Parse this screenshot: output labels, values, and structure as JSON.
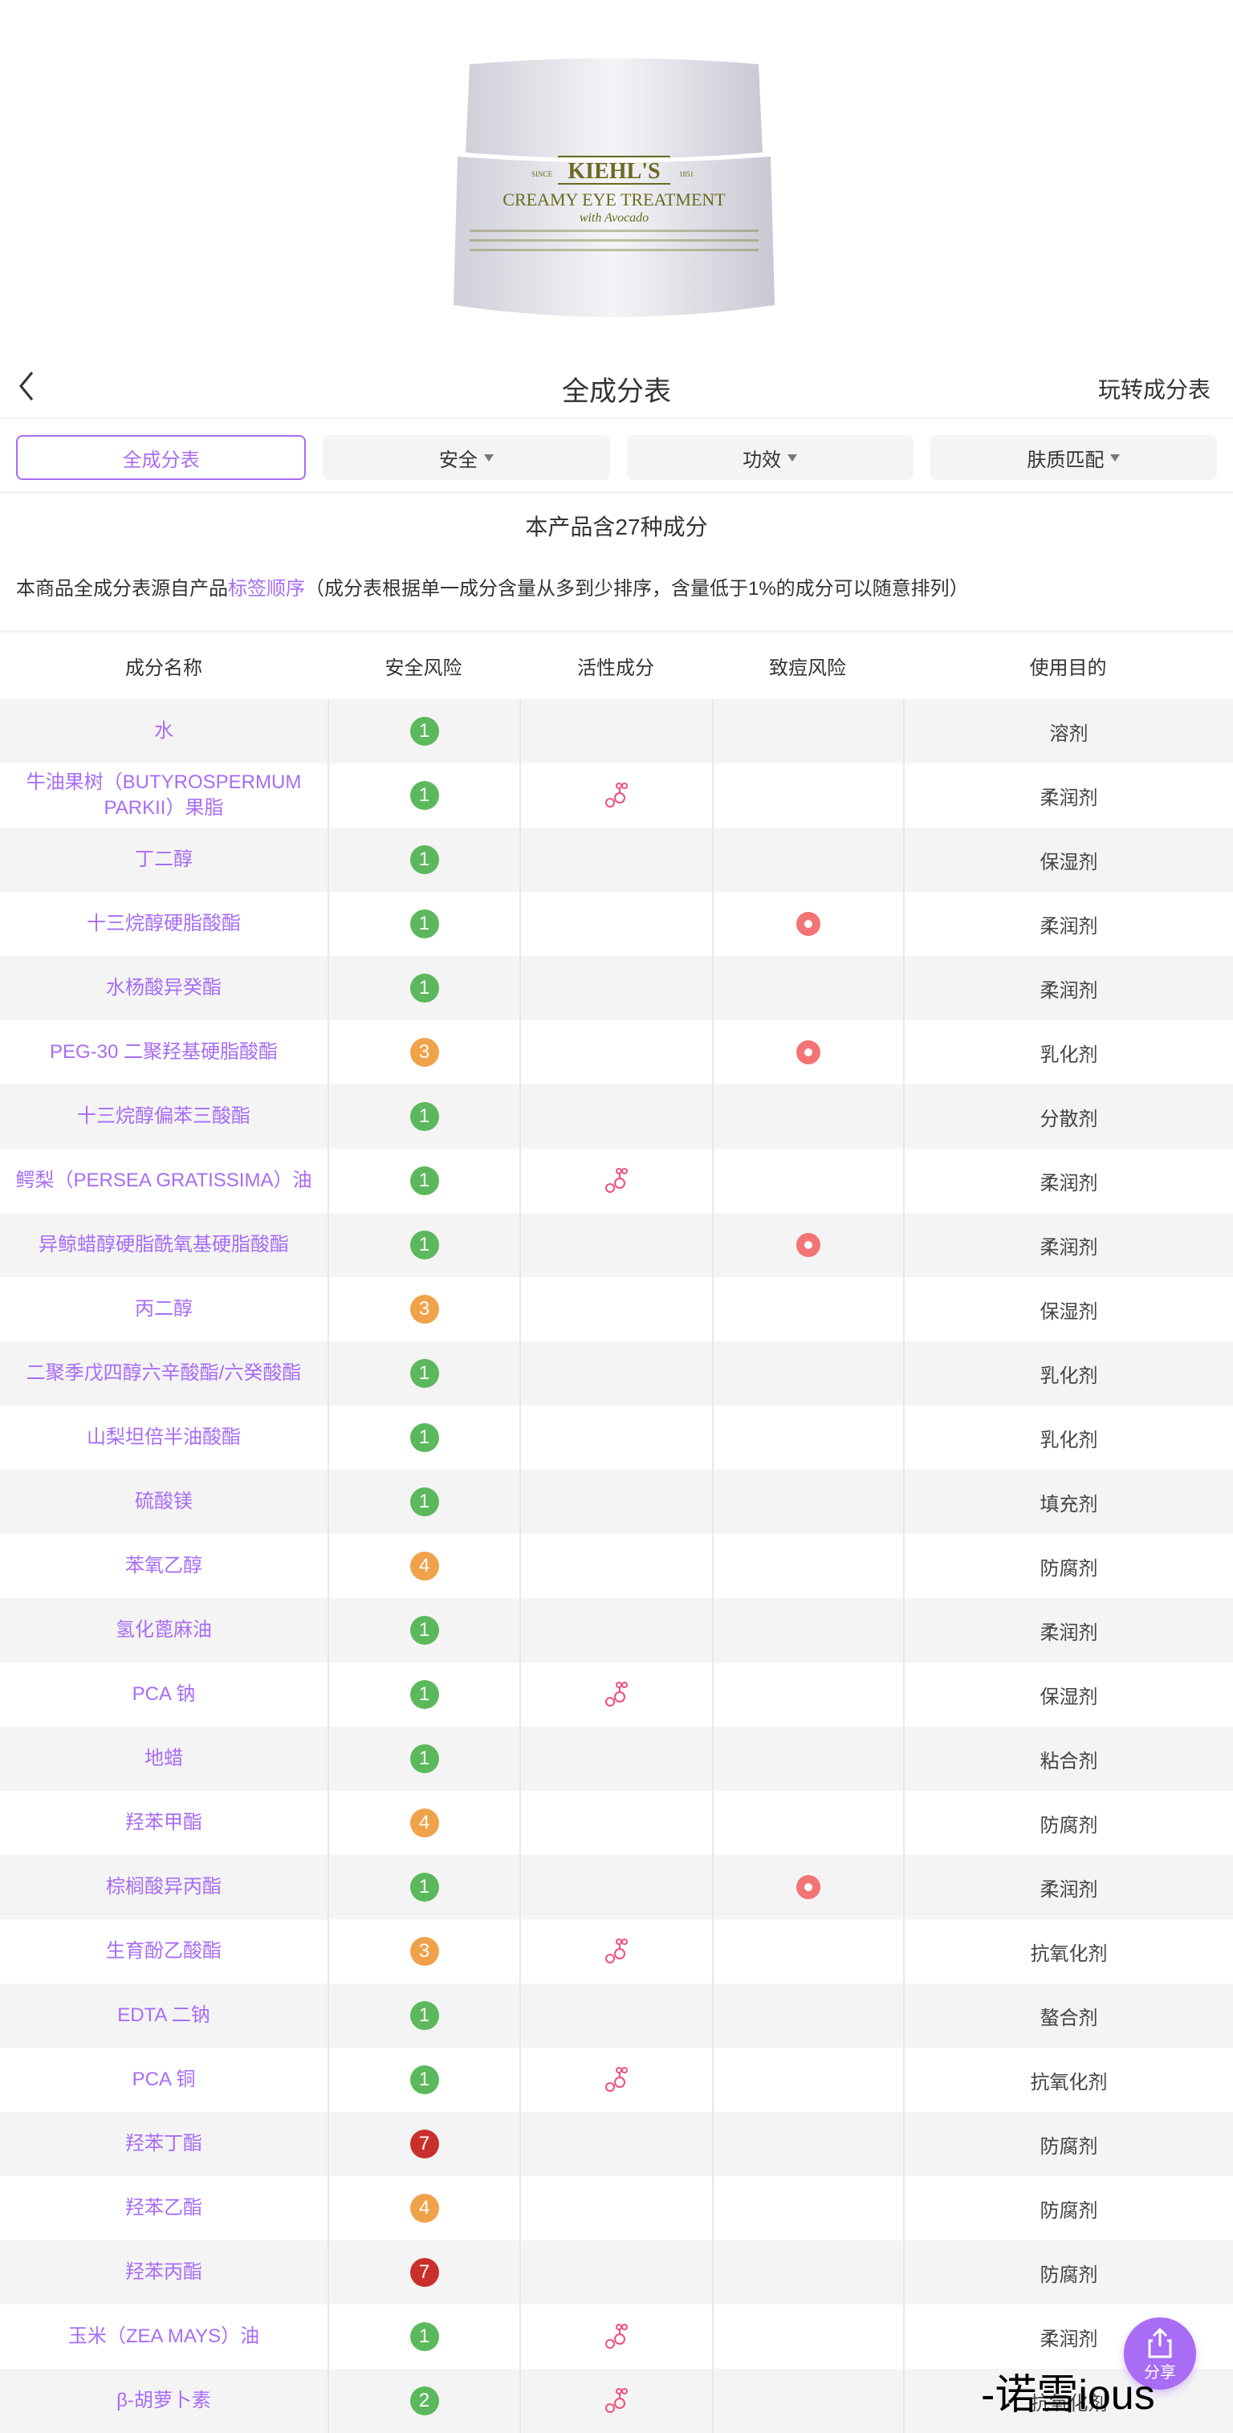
{
  "product": {
    "brand": "KIEHL'S",
    "since": "SINCE",
    "year": "1851",
    "name": "CREAMY EYE TREATMENT",
    "sub": "with Avocado"
  },
  "nav": {
    "title": "全成分表",
    "right_link": "玩转成分表"
  },
  "filters": [
    {
      "label": "全成分表",
      "active": true
    },
    {
      "label": "安全"
    },
    {
      "label": "功效"
    },
    {
      "label": "肤质匹配"
    }
  ],
  "summary": "本产品含27种成分",
  "note": {
    "prefix": "本商品全成分表源自产品",
    "link": "标签顺序",
    "suffix": "（成分表根据单一成分含量从多到少排序，含量低于1%的成分可以随意排列）"
  },
  "columns": [
    "成分名称",
    "安全风险",
    "活性成分",
    "致痘风险",
    "使用目的"
  ],
  "colors": {
    "accent": "#a86cf5",
    "risk_low": "#5cb85c",
    "risk_mid": "#f0a24a",
    "risk_high": "#c9302c",
    "acne": "#f27476",
    "active": "#f0507a"
  },
  "rows": [
    {
      "name": "水",
      "risk": "1",
      "active": false,
      "acne": false,
      "purpose": "溶剂"
    },
    {
      "name": "牛油果树（BUTYROSPERMUM PARKII）果脂",
      "risk": "1",
      "active": true,
      "acne": false,
      "purpose": "柔润剂"
    },
    {
      "name": "丁二醇",
      "risk": "1",
      "active": false,
      "acne": false,
      "purpose": "保湿剂"
    },
    {
      "name": "十三烷醇硬脂酸酯",
      "risk": "1",
      "active": false,
      "acne": true,
      "purpose": "柔润剂"
    },
    {
      "name": "水杨酸异癸酯",
      "risk": "1",
      "active": false,
      "acne": false,
      "purpose": "柔润剂"
    },
    {
      "name": "PEG-30 二聚羟基硬脂酸酯",
      "risk": "3",
      "active": false,
      "acne": true,
      "purpose": "乳化剂"
    },
    {
      "name": "十三烷醇偏苯三酸酯",
      "risk": "1",
      "active": false,
      "acne": false,
      "purpose": "分散剂"
    },
    {
      "name": "鳄梨（PERSEA GRATISSIMA）油",
      "risk": "1",
      "active": true,
      "acne": false,
      "purpose": "柔润剂"
    },
    {
      "name": "异鲸蜡醇硬脂酰氧基硬脂酸酯",
      "risk": "1",
      "active": false,
      "acne": true,
      "purpose": "柔润剂"
    },
    {
      "name": "丙二醇",
      "risk": "3",
      "active": false,
      "acne": false,
      "purpose": "保湿剂"
    },
    {
      "name": "二聚季戊四醇六辛酸酯/六癸酸酯",
      "risk": "1",
      "active": false,
      "acne": false,
      "purpose": "乳化剂"
    },
    {
      "name": "山梨坦倍半油酸酯",
      "risk": "1",
      "active": false,
      "acne": false,
      "purpose": "乳化剂"
    },
    {
      "name": "硫酸镁",
      "risk": "1",
      "active": false,
      "acne": false,
      "purpose": "填充剂"
    },
    {
      "name": "苯氧乙醇",
      "risk": "4",
      "active": false,
      "acne": false,
      "purpose": "防腐剂"
    },
    {
      "name": "氢化蓖麻油",
      "risk": "1",
      "active": false,
      "acne": false,
      "purpose": "柔润剂"
    },
    {
      "name": "PCA 钠",
      "risk": "1",
      "active": true,
      "acne": false,
      "purpose": "保湿剂"
    },
    {
      "name": "地蜡",
      "risk": "1",
      "active": false,
      "acne": false,
      "purpose": "粘合剂"
    },
    {
      "name": "羟苯甲酯",
      "risk": "4",
      "active": false,
      "acne": false,
      "purpose": "防腐剂"
    },
    {
      "name": "棕榈酸异丙酯",
      "risk": "1",
      "active": false,
      "acne": true,
      "purpose": "柔润剂"
    },
    {
      "name": "生育酚乙酸酯",
      "risk": "3",
      "active": true,
      "acne": false,
      "purpose": "抗氧化剂"
    },
    {
      "name": "EDTA 二钠",
      "risk": "1",
      "active": false,
      "acne": false,
      "purpose": "螯合剂"
    },
    {
      "name": "PCA 铜",
      "risk": "1",
      "active": true,
      "acne": false,
      "purpose": "抗氧化剂"
    },
    {
      "name": "羟苯丁酯",
      "risk": "7",
      "active": false,
      "acne": false,
      "purpose": "防腐剂"
    },
    {
      "name": "羟苯乙酯",
      "risk": "4",
      "active": false,
      "acne": false,
      "purpose": "防腐剂"
    },
    {
      "name": "羟苯丙酯",
      "risk": "7",
      "active": false,
      "acne": false,
      "purpose": "防腐剂"
    },
    {
      "name": "玉米（ZEA MAYS）油",
      "risk": "1",
      "active": true,
      "acne": false,
      "purpose": "柔润剂"
    },
    {
      "name": "β-胡萝卜素",
      "risk": "2",
      "active": true,
      "acne": false,
      "purpose": "抗氧化剂"
    }
  ],
  "share": {
    "label": "分享"
  },
  "watermark": "-诺雪ious"
}
